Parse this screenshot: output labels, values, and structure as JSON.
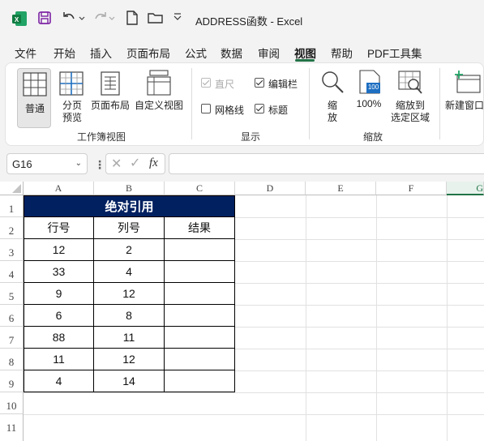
{
  "window": {
    "title": "ADDRESS函数  -  Excel"
  },
  "menu": {
    "items": [
      "文件",
      "开始",
      "插入",
      "页面布局",
      "公式",
      "数据",
      "审阅",
      "视图",
      "帮助",
      "PDF工具集"
    ],
    "active": "视图"
  },
  "ribbon": {
    "workbook_views": {
      "group_label": "工作簿视图",
      "buttons": [
        "普通",
        "分页\n预览",
        "页面布局",
        "自定义视图"
      ],
      "normal": "普通",
      "page_break_1": "分页",
      "page_break_2": "预览",
      "page_layout": "页面布局",
      "custom_views": "自定义视图"
    },
    "show": {
      "group_label": "显示",
      "ruler": "直尺",
      "formula_bar": "编辑栏",
      "gridlines": "网格线",
      "headings": "标题",
      "ruler_checked": true,
      "formula_bar_checked": true,
      "gridlines_checked": false,
      "headings_checked": true
    },
    "zoom": {
      "group_label": "缩放",
      "zoom_1": "缩",
      "zoom_2": "放",
      "zoom_100": "100%",
      "zoom_100_icon": "100",
      "zoom_sel_1": "缩放到",
      "zoom_sel_2": "选定区域"
    },
    "window": {
      "new_window": "新建窗口"
    }
  },
  "formula_bar": {
    "name_box": "G16",
    "fx": "fx",
    "value": ""
  },
  "sheet": {
    "columns": [
      "A",
      "B",
      "C",
      "D",
      "E",
      "F",
      "G"
    ],
    "rows": [
      "1",
      "2",
      "3",
      "4",
      "5",
      "6",
      "7",
      "8",
      "9",
      "10",
      "11"
    ],
    "table_title": "绝对引用",
    "headers": [
      "行号",
      "列号",
      "结果"
    ],
    "data": [
      [
        "12",
        "2",
        ""
      ],
      [
        "33",
        "4",
        ""
      ],
      [
        "9",
        "12",
        ""
      ],
      [
        "6",
        "8",
        ""
      ],
      [
        "88",
        "11",
        ""
      ],
      [
        "11",
        "12",
        ""
      ],
      [
        "4",
        "14",
        ""
      ]
    ]
  },
  "colors": {
    "accent": "#217346",
    "title_bg": "#002060",
    "title_fg": "#ffffff"
  }
}
